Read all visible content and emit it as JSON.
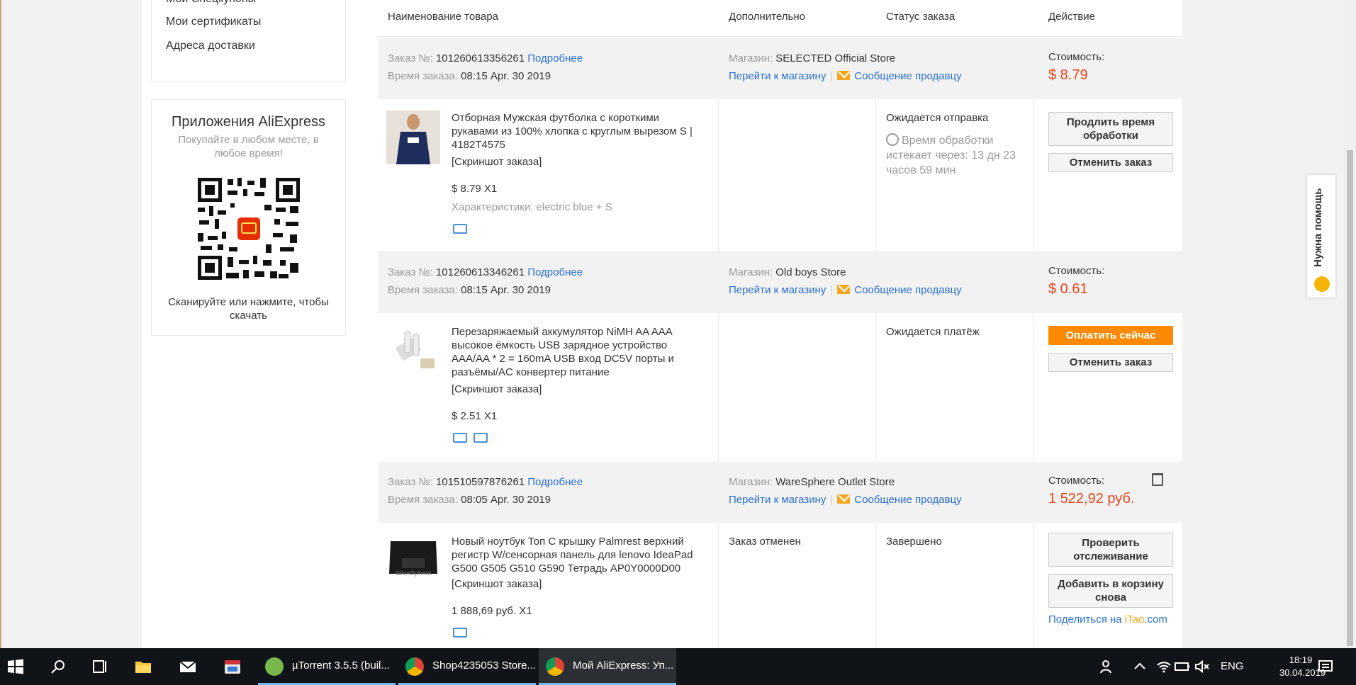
{
  "sidebar": {
    "links": [
      "Мои Спецкупоны",
      "Мои сертификаты",
      "Адреса доставки"
    ],
    "app": {
      "title": "Приложения AliExpress",
      "subtitle": "Покупайте в любом месте, в любое время!",
      "scan_text": "Сканируйте или нажмите, чтобы скачать",
      "qr_logo": "AliExpress"
    }
  },
  "table": {
    "headers": [
      "Наименование товара",
      "Дополнительно",
      "Статус заказа",
      "Действие"
    ]
  },
  "labels": {
    "order_no": "Заказ №:",
    "details": "Подробнее",
    "order_time": "Время заказа:",
    "store": "Магазин:",
    "go_to_store": "Перейти к магазину",
    "message_seller": "Сообщение продавцу",
    "cost": "Стоимость:",
    "screenshot": "[Скриншот заказа]",
    "characteristics": "Характеристики:"
  },
  "orders": [
    {
      "number": "101260613356261",
      "time": "08:15 Apr. 30 2019",
      "store": "SELECTED Official Store",
      "cost": "$ 8.79",
      "product": "Отборная Мужская футболка с короткими рукавами из 100% хлопка с круглым вырезом S | 4182T4575",
      "price_qty": "$ 8.79 X1",
      "characteristics": "electric blue + S",
      "extra": "",
      "status": "Ожидается отправка",
      "processing": "Время обработки истекает через: 13 дн 23 часов 59 мин",
      "buttons": [
        "Продлить время обработки",
        "Отменить заказ"
      ]
    },
    {
      "number": "101260613346261",
      "time": "08:15 Apr. 30 2019",
      "store": "Old boys Store",
      "cost": "$ 0.61",
      "product": "Перезаряжаемый аккумулятор NiMH AA AAA высокое ёмкость USB зарядное устройство AAA/AA * 2 = 160mA USB вход DC5V порты и разъёмы/AC конвертер питание",
      "price_qty": "$ 2.51 X1",
      "extra": "",
      "status": "Ожидается платёж",
      "buttons": [
        "Оплатить сейчас",
        "Отменить заказ"
      ]
    },
    {
      "number": "101510597876261",
      "time": "08:05 Apr. 30 2019",
      "store": "WareSphere Outlet Store",
      "cost": "1 522,92 руб.",
      "product": "Новый ноутбук Топ С крышку Palmrest верхний регистр W/сенсорная панель для lenovo IdeaPad G500 G505 G510 G590 Тетрадь AP0Y0000D00",
      "price_qty": "1 888,69 руб. X1",
      "extra": "Заказ отменен",
      "status": "Завершено",
      "buttons": [
        "Проверить отслеживание",
        "Добавить в корзину снова"
      ],
      "share_prefix": "Поделиться на ",
      "share_site_i": "iTao",
      "share_site_rest": ".com",
      "thumb_brand": "WareSphere"
    }
  ],
  "help": {
    "label": "Нужна помощь"
  },
  "taskbar": {
    "apps": [
      {
        "label": "µTorrent 3.5.5  (buil..."
      },
      {
        "label": "Shop4235053 Store..."
      },
      {
        "label": "Мой AliExpress: Уп..."
      }
    ],
    "lang": "ENG",
    "time": "18:19",
    "date": "30.04.2019"
  },
  "colors": {
    "price": "#e8471c",
    "link": "#2a6fc9",
    "pay_button": "#ff8a00",
    "taskbar": "#101418"
  }
}
